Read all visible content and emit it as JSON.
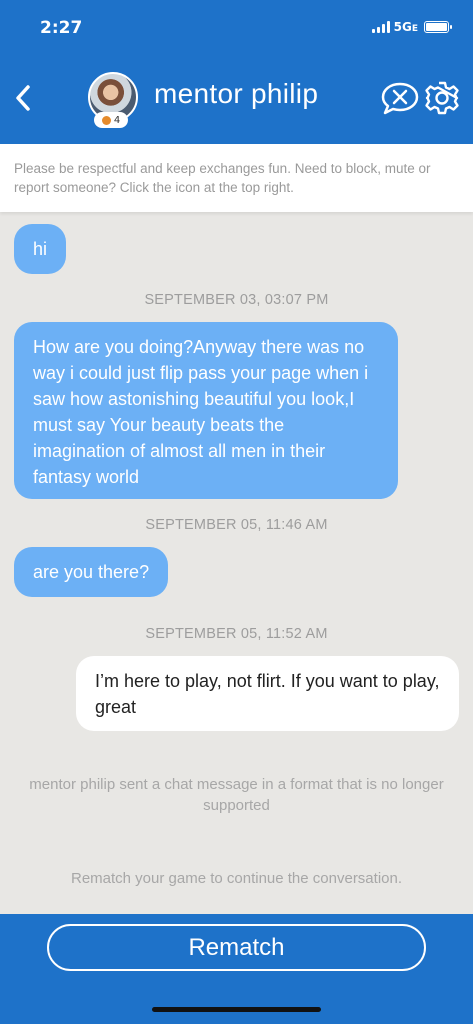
{
  "status_bar": {
    "time": "2:27",
    "network": "5G",
    "network_suffix": "E"
  },
  "header": {
    "title": "mentor philip",
    "avatar_level": "4",
    "back_icon": "chevron-left-icon",
    "mute_icon": "chat-close-icon",
    "settings_icon": "gear-icon"
  },
  "notice": "Please be respectful and keep exchanges fun. Need to block, mute or report someone? Click the icon at the top right.",
  "messages": [
    {
      "type": "in",
      "text": "hi"
    },
    {
      "type": "timestamp",
      "text": "SEPTEMBER 03, 03:07 PM"
    },
    {
      "type": "in",
      "text": "How are you doing?Anyway there was no way i could just flip pass your page when i saw how astonishing beautiful you look,I must say Your beauty beats the imagination of almost all men in their fantasy world"
    },
    {
      "type": "timestamp",
      "text": "SEPTEMBER 05, 11:46 AM"
    },
    {
      "type": "in",
      "text": "are you there?"
    },
    {
      "type": "timestamp",
      "text": "SEPTEMBER 05, 11:52 AM"
    },
    {
      "type": "out",
      "text": "I’m here to play, not flirt. If you want to play, great"
    }
  ],
  "system_message": "mentor philip sent a chat message in a format that is no longer supported",
  "rematch_hint": "Rematch your game to continue the conversation.",
  "footer": {
    "rematch_label": "Rematch"
  },
  "colors": {
    "brand_blue": "#1e72c9",
    "incoming_bubble": "#6cb0f5",
    "chat_background": "#e8e7e4"
  }
}
